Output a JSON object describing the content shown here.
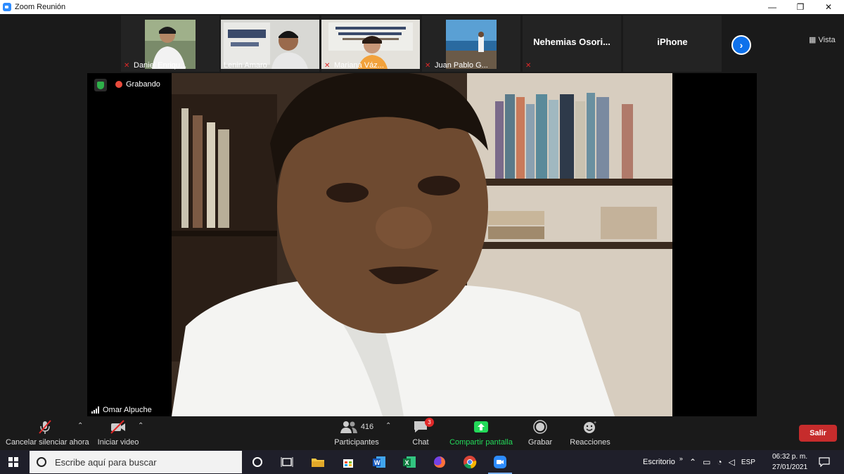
{
  "window": {
    "title": "Zoom Reunión",
    "minimize": "—",
    "restore": "❐",
    "close": "✕"
  },
  "participants_strip": {
    "tiles": [
      {
        "name": "Daniel Enriqu...",
        "muted": true
      },
      {
        "name": "Lenin Amaro",
        "muted": false
      },
      {
        "name": "Mariana Váz...",
        "muted": true
      },
      {
        "name": "Juan Pablo G...",
        "muted": true
      },
      {
        "name": "Nehemias  Osori...",
        "muted": true
      },
      {
        "name": "iPhone",
        "muted": false
      }
    ],
    "next_icon": "›",
    "view_label": "Vista"
  },
  "main_video": {
    "recording_label": "Grabando",
    "speaker_name": "Omar Alpuche"
  },
  "controls": {
    "mute_label": "Cancelar silenciar ahora",
    "video_label": "Iniciar video",
    "participants_count": "416",
    "participants_label": "Participantes",
    "chat_badge": "3",
    "chat_label": "Chat",
    "share_label": "Compartir pantalla",
    "record_label": "Grabar",
    "reactions_label": "Reacciones",
    "leave_label": "Salir"
  },
  "taskbar": {
    "search_placeholder": "Escribe aquí para buscar",
    "desktop_label": "Escritorio",
    "lang": "ESP",
    "time": "06:32 p. m.",
    "date": "27/01/2021"
  },
  "colors": {
    "accent": "#0e71eb",
    "share_green": "#23d959",
    "leave_red": "#c62c2c",
    "mute_red": "#e02828"
  }
}
